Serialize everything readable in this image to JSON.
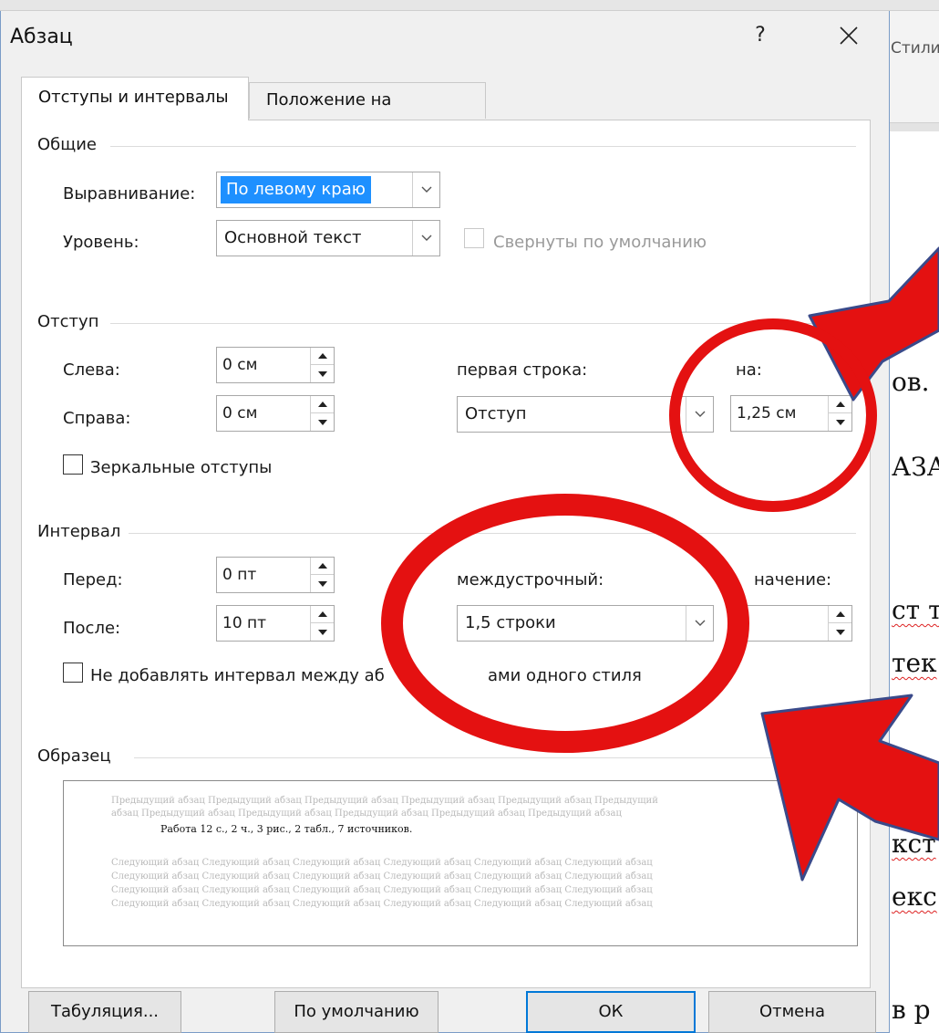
{
  "dialog": {
    "title": "Абзац",
    "help": "?",
    "close": "✕",
    "tabs": [
      {
        "label": "Отступы и интервалы",
        "active": true
      },
      {
        "label": "Положение на странице",
        "active": false
      }
    ]
  },
  "general": {
    "title": "Общие",
    "alignment_label": "Выравнивание:",
    "alignment_value": "По левому краю",
    "level_label": "Уровень:",
    "level_value": "Основной текст",
    "collapsed_label": "Свернуты по умолчанию"
  },
  "indent": {
    "title": "Отступ",
    "left_label": "Слева:",
    "left_value": "0 см",
    "right_label": "Справа:",
    "right_value": "0 см",
    "first_line_label": "первая строка:",
    "first_line_value": "Отступ",
    "by_label": "на:",
    "by_value": "1,25 см",
    "mirror_label": "Зеркальные отступы"
  },
  "spacing": {
    "title": "Интервал",
    "before_label": "Перед:",
    "before_value": "0 пт",
    "after_label": "После:",
    "after_value": "10 пт",
    "line_label": "междустрочный:",
    "line_value": "1,5 строки",
    "value_label": "начение:",
    "no_space_label": "Не добавлять интервал между аб",
    "no_space_label_tail": "ами одного стиля"
  },
  "preview": {
    "title": "Образец",
    "prev_line1": "Предыдущий абзац Предыдущий абзац Предыдущий абзац Предыдущий абзац Предыдущий абзац Предыдущий",
    "prev_line2": "абзац Предыдущий абзац Предыдущий абзац Предыдущий абзац Предыдущий абзац Предыдущий абзац",
    "current": "Работа 12 с., 2 ч., 3 рис., 2 табл., 7 источников.",
    "next_line": "Следующий абзац Следующий абзац Следующий абзац Следующий абзац Следующий абзац Следующий абзац"
  },
  "buttons": {
    "tabs": "Табуляция...",
    "default": "По умолчанию",
    "ok": "ОК",
    "cancel": "Отмена"
  },
  "background": {
    "styles": "Стили",
    "lines": [
      "ов.",
      "АЗА",
      "ст т",
      "тек",
      "кст",
      "екс",
      "в р"
    ]
  },
  "colors": {
    "annotation": "#e41111",
    "annotation_outline": "#3a4a8a",
    "selection": "#1e90ff"
  }
}
